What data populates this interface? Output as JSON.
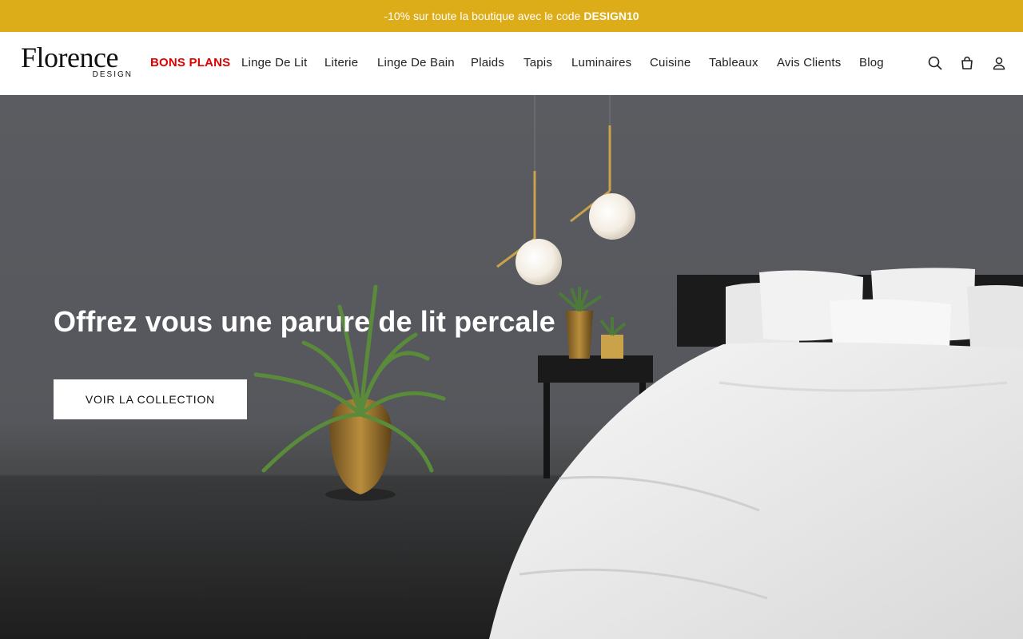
{
  "promo": {
    "text": "-10% sur toute la boutique avec le code",
    "code": "DESIGN10",
    "color": "#dcac19"
  },
  "logo": {
    "name": "Florence",
    "sub": "DESIGN"
  },
  "nav": {
    "items": [
      {
        "label": "BONS PLANS",
        "highlight": true,
        "color": "#e00000"
      },
      {
        "label": "Linge De Lit"
      },
      {
        "label": "Literie"
      },
      {
        "label": "Linge De Bain"
      },
      {
        "label": "Plaids"
      },
      {
        "label": "Tapis"
      },
      {
        "label": "Luminaires"
      },
      {
        "label": "Cuisine"
      },
      {
        "label": "Tableaux"
      },
      {
        "label": "Avis Clients"
      },
      {
        "label": "Blog"
      }
    ]
  },
  "icons": [
    "search-icon",
    "cart-icon",
    "account-icon"
  ],
  "hero": {
    "title": "Offrez vous une parure de lit percale",
    "button_label": "VOIR LA COLLECTION"
  }
}
